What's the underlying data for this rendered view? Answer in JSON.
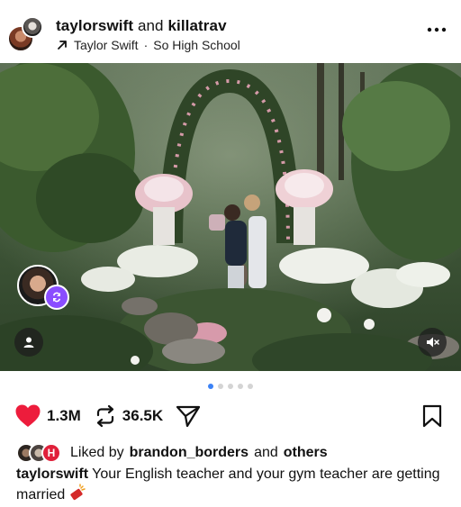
{
  "header": {
    "user1": "taylorswift",
    "joiner": "and",
    "user2": "killatrav",
    "music_artist": "Taylor Swift",
    "music_separator": "·",
    "music_track": "So High School"
  },
  "carousel": {
    "total": 5,
    "active_index": 0
  },
  "actions": {
    "likes": "1.3M",
    "reposts": "36.5K",
    "liked": true
  },
  "liked_by": {
    "prefix": "Liked by",
    "user": "brandon_borders",
    "joiner": "and",
    "others": "others"
  },
  "caption": {
    "user": "taylorswift",
    "text": "Your English teacher and your gym teacher are getting married"
  },
  "icons": {
    "more": "more-horizontal-icon",
    "music": "arrow-up-right-icon",
    "like": "heart-icon",
    "repost": "repost-icon",
    "share": "send-icon",
    "save": "bookmark-icon",
    "tag": "user-tag-icon",
    "mute": "mute-icon"
  },
  "colors": {
    "like": "#ed1c3c",
    "repost_badge": "#8a4dff",
    "active_dot": "#3b82f6"
  }
}
